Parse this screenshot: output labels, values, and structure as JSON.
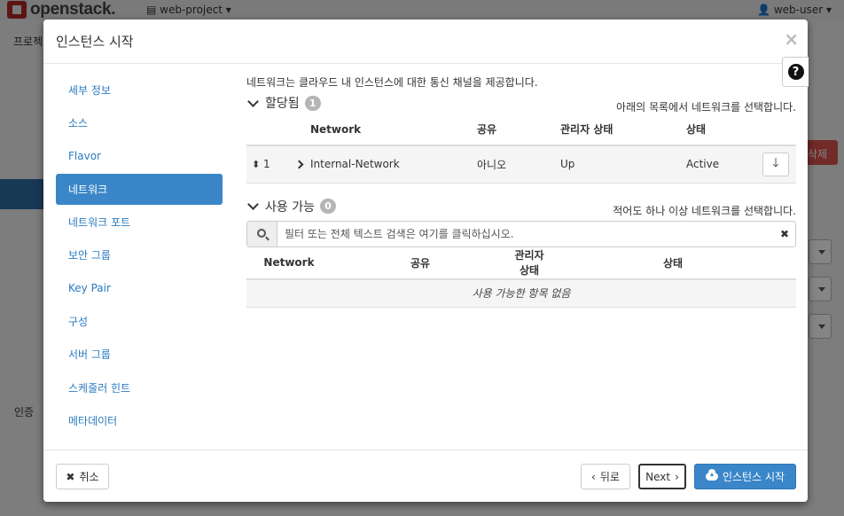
{
  "background": {
    "logo_text": "openstack.",
    "project_selector": "web-project",
    "user_menu": "web-user",
    "breadcrumb": "프로젝트",
    "sidebar_auth": "인증",
    "delete_button": "삭제"
  },
  "modal": {
    "title": "인스턴스 시작",
    "close_icon": "×",
    "help_icon": "?",
    "nav": [
      {
        "label": "세부 정보",
        "active": false
      },
      {
        "label": "소스",
        "active": false
      },
      {
        "label": "Flavor",
        "active": false
      },
      {
        "label": "네트워크",
        "active": true
      },
      {
        "label": "네트워크 포트",
        "active": false
      },
      {
        "label": "보안 그룹",
        "active": false
      },
      {
        "label": "Key Pair",
        "active": false
      },
      {
        "label": "구성",
        "active": false
      },
      {
        "label": "서버 그룹",
        "active": false
      },
      {
        "label": "스케줄러 힌트",
        "active": false
      },
      {
        "label": "메타데이터",
        "active": false
      }
    ],
    "intro": "네트워크는 클라우드 내 인스턴스에 대한 통신 채널을 제공합니다.",
    "allocated": {
      "title": "할당됨",
      "count": "1",
      "hint": "아래의 목록에서 네트워크를 선택합니다.",
      "columns": [
        "Network",
        "공유",
        "관리자 상태",
        "상태"
      ],
      "rows": [
        {
          "order": "1",
          "network": "Internal-Network",
          "shared": "아니오",
          "admin_state": "Up",
          "status": "Active"
        }
      ]
    },
    "available": {
      "title": "사용 가능",
      "count": "0",
      "hint": "적어도 하나 이상 네트워크를 선택합니다.",
      "filter_placeholder": "필터 또는 전체 텍스트 검색은 여기를 클릭하십시오.",
      "columns": [
        "Network",
        "공유",
        "관리자 상태",
        "상태"
      ],
      "empty_text": "사용 가능한 항목 없음"
    },
    "footer": {
      "cancel": "취소",
      "back": "뒤로",
      "next": "Next",
      "launch": "인스턴스 시작"
    }
  },
  "colors": {
    "accent": "#3a86c8",
    "danger": "#d9534f"
  }
}
